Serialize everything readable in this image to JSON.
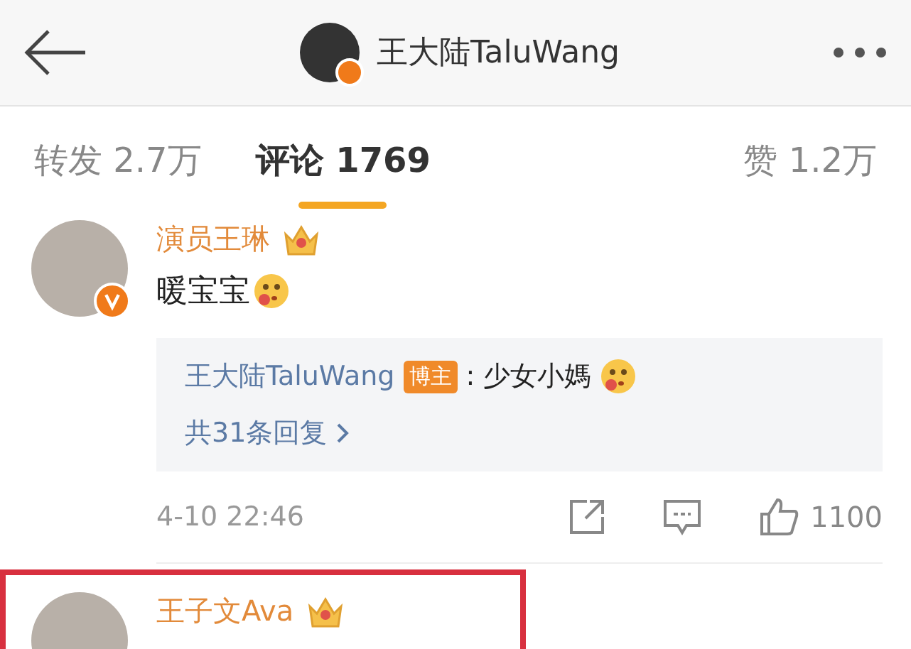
{
  "header": {
    "title": "王大陆TaluWang",
    "verified": true
  },
  "tabs": [
    {
      "label": "转发 2.7万",
      "selected": false
    },
    {
      "label": "评论 1769",
      "selected": true
    },
    {
      "label": "赞 1.2万",
      "selected": false
    }
  ],
  "comments": [
    {
      "author": "演员王琳",
      "verified": true,
      "highlighted": false,
      "text": "暖宝宝",
      "reply": {
        "author": "王大陆TaluWang",
        "badge": "博主",
        "text": ": 少女小媽"
      },
      "more": "共31条回复",
      "time": "4-10 22:46",
      "likes": "1100"
    },
    {
      "author": "王子文Ava",
      "highlighted": true
    }
  ]
}
